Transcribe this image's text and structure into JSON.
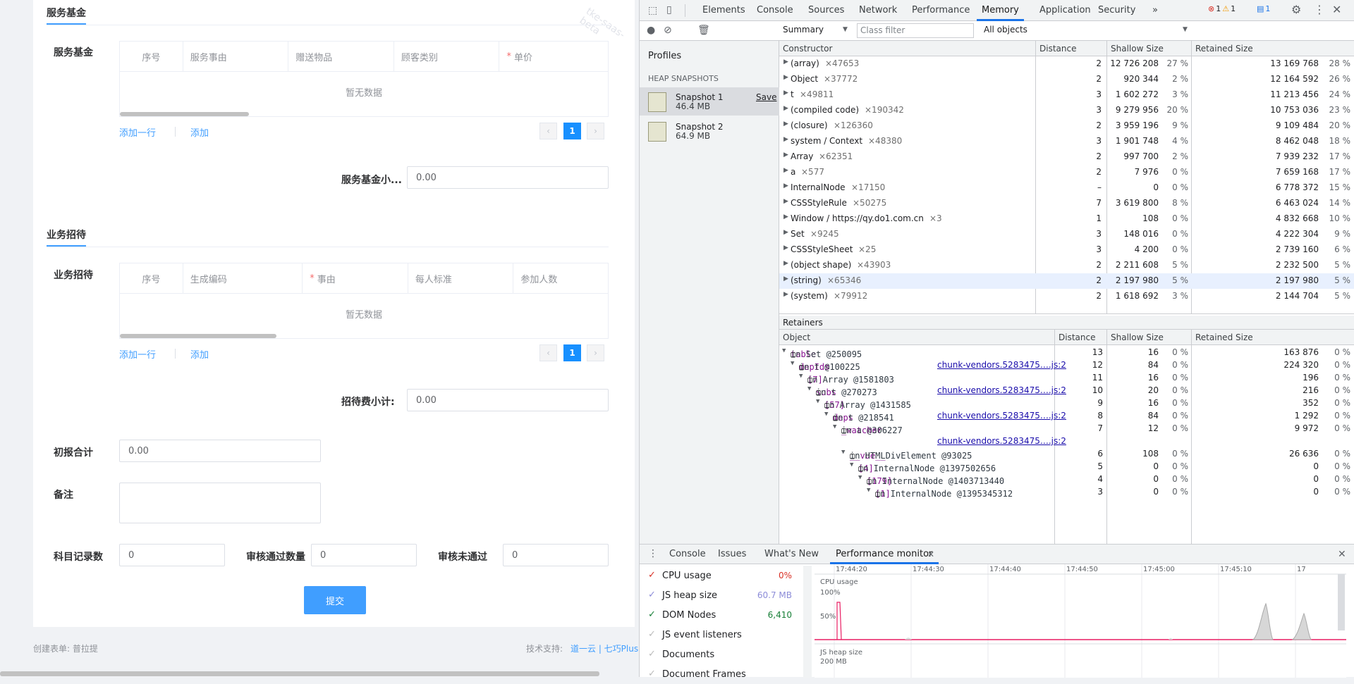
{
  "form": {
    "section1_title": "服务基金",
    "section1_label": "服务基金",
    "table1_headers": [
      "序号",
      "服务事由",
      "赠送物品",
      "顾客类别",
      "单价"
    ],
    "table1_empty": "暂无数据",
    "add_row": "添加一行",
    "add": "添加",
    "page_current": "1",
    "subtotal1_label": "服务基金小...",
    "subtotal1_value": "0.00",
    "section2_title": "业务招待",
    "section2_label": "业务招待",
    "table2_headers": [
      "序号",
      "生成编码",
      "事由",
      "每人标准",
      "参加人数"
    ],
    "table2_empty": "暂无数据",
    "subtotal2_label": "招待费小计:",
    "subtotal2_value": "0.00",
    "total_label": "初报合计",
    "total_value": "0.00",
    "remark_label": "备注",
    "count_label": "科目记录数",
    "count_value": "0",
    "passed_label": "审核通过数量",
    "passed_value": "0",
    "rejected_label": "审核未通过",
    "rejected_value": "0",
    "submit": "提交",
    "creator": "创建表单: 普拉提",
    "support_label": "技术支持:",
    "support_link": "道一云 | 七巧Plus",
    "watermark": "tke-saas-beta"
  },
  "devtools": {
    "tabs": [
      "Elements",
      "Console",
      "Sources",
      "Network",
      "Performance",
      "Memory",
      "Application",
      "Security"
    ],
    "active_tab": "Memory",
    "more": "»",
    "errors": "1",
    "warnings": "1",
    "messages": "1",
    "summary_select": "Summary",
    "class_filter_placeholder": "Class filter",
    "objects_select": "All objects",
    "profiles_label": "Profiles",
    "heap_snapshots": "HEAP SNAPSHOTS",
    "snapshots": [
      {
        "name": "Snapshot 1",
        "size": "46.4 MB",
        "save": "Save"
      },
      {
        "name": "Snapshot 2",
        "size": "64.9 MB",
        "save": ""
      }
    ],
    "grid_headers": [
      "Constructor",
      "Distance",
      "Shallow Size",
      "Retained Size"
    ],
    "rows": [
      {
        "name": "(array)",
        "count": "×47653",
        "dist": "2",
        "shallow": "12 726 208",
        "sp": "27 %",
        "retained": "13 169 768",
        "rp": "28 %"
      },
      {
        "name": "Object",
        "count": "×37772",
        "dist": "2",
        "shallow": "920 344",
        "sp": "2 %",
        "retained": "12 164 592",
        "rp": "26 %"
      },
      {
        "name": "t",
        "count": "×49811",
        "dist": "3",
        "shallow": "1 602 272",
        "sp": "3 %",
        "retained": "11 213 456",
        "rp": "24 %"
      },
      {
        "name": "(compiled code)",
        "count": "×190342",
        "dist": "3",
        "shallow": "9 279 956",
        "sp": "20 %",
        "retained": "10 753 036",
        "rp": "23 %"
      },
      {
        "name": "(closure)",
        "count": "×126360",
        "dist": "2",
        "shallow": "3 959 196",
        "sp": "9 %",
        "retained": "9 109 484",
        "rp": "20 %"
      },
      {
        "name": "system / Context",
        "count": "×48380",
        "dist": "3",
        "shallow": "1 901 748",
        "sp": "4 %",
        "retained": "8 462 048",
        "rp": "18 %"
      },
      {
        "name": "Array",
        "count": "×62351",
        "dist": "2",
        "shallow": "997 700",
        "sp": "2 %",
        "retained": "7 939 232",
        "rp": "17 %"
      },
      {
        "name": "a",
        "count": "×577",
        "dist": "2",
        "shallow": "7 976",
        "sp": "0 %",
        "retained": "7 659 168",
        "rp": "17 %"
      },
      {
        "name": "InternalNode",
        "count": "×17150",
        "dist": "–",
        "shallow": "0",
        "sp": "0 %",
        "retained": "6 778 372",
        "rp": "15 %"
      },
      {
        "name": "CSSStyleRule",
        "count": "×50275",
        "dist": "7",
        "shallow": "3 619 800",
        "sp": "8 %",
        "retained": "6 463 024",
        "rp": "14 %"
      },
      {
        "name": "Window / https://qy.do1.com.cn",
        "count": "×3",
        "dist": "1",
        "shallow": "108",
        "sp": "0 %",
        "retained": "4 832 668",
        "rp": "10 %"
      },
      {
        "name": "Set",
        "count": "×9245",
        "dist": "3",
        "shallow": "148 016",
        "sp": "0 %",
        "retained": "4 222 304",
        "rp": "9 %"
      },
      {
        "name": "CSSStyleSheet",
        "count": "×25",
        "dist": "3",
        "shallow": "4 200",
        "sp": "0 %",
        "retained": "2 739 160",
        "rp": "6 %"
      },
      {
        "name": "(object shape)",
        "count": "×43903",
        "dist": "2",
        "shallow": "2 211 608",
        "sp": "5 %",
        "retained": "2 232 500",
        "rp": "5 %"
      },
      {
        "name": "(string)",
        "count": "×65346",
        "dist": "2",
        "shallow": "2 197 980",
        "sp": "5 %",
        "retained": "2 197 980",
        "rp": "5 %"
      },
      {
        "name": "(system)",
        "count": "×79912",
        "dist": "2",
        "shallow": "1 618 692",
        "sp": "3 %",
        "retained": "2 144 704",
        "rp": "5 %"
      }
    ],
    "retainers_label": "Retainers",
    "ret_headers": [
      "Object",
      "Distance",
      "Shallow Size",
      "Retained Size"
    ],
    "ret_rows": [
      {
        "prop": "table",
        "rest": " in Set @250095 ",
        "src": "",
        "dist": "13",
        "shallow": "16",
        "sp": "0 %",
        "retained": "163 876",
        "rp": "0 %"
      },
      {
        "prop": "depIds",
        "rest": " in t @100225 ",
        "src": "chunk-vendors.5283475….js:2",
        "dist": "12",
        "shallow": "84",
        "sp": "0 %",
        "retained": "224 320",
        "rp": "0 %"
      },
      {
        "prop": "[7]",
        "rest": " in Array @1581803 ",
        "src": "",
        "dist": "11",
        "shallow": "16",
        "sp": "0 %",
        "retained": "196",
        "rp": "0 %"
      },
      {
        "prop": "subs",
        "rest": " in t @270273 ",
        "src": "chunk-vendors.5283475….js:2",
        "dist": "10",
        "shallow": "20",
        "sp": "0 %",
        "retained": "216",
        "rp": "0 %"
      },
      {
        "prop": "[57]",
        "rest": " in Array @1431585 ",
        "src": "",
        "dist": "9",
        "shallow": "16",
        "sp": "0 %",
        "retained": "352",
        "rp": "0 %"
      },
      {
        "prop": "deps",
        "rest": " in t @218541 ",
        "src": "chunk-vendors.5283475….js:2",
        "dist": "8",
        "shallow": "84",
        "sp": "0 %",
        "retained": "1 292",
        "rp": "0 %"
      },
      {
        "prop": "_watcher",
        "rest": " in a @306227 ",
        "src": "",
        "dist": "7",
        "shallow": "12",
        "sp": "0 %",
        "retained": "9 972",
        "rp": "0 %"
      },
      {
        "prop": "",
        "rest": "",
        "src": "chunk-vendors.5283475….js:2",
        "dist": "",
        "shallow": "",
        "sp": "",
        "retained": "",
        "rp": ""
      },
      {
        "prop": "__vue__",
        "rest": " in HTMLDivElement @93025 ",
        "src": "",
        "dist": "6",
        "shallow": "108",
        "sp": "0 %",
        "retained": "26 636",
        "rp": "0 %"
      },
      {
        "prop": "[4]",
        "rest": " in InternalNode @1397502656 ",
        "src": "",
        "dist": "5",
        "shallow": "0",
        "sp": "0 %",
        "retained": "0",
        "rp": "0 %"
      },
      {
        "prop": "[179]",
        "rest": " in InternalNode @1403713440 ",
        "src": "",
        "dist": "4",
        "shallow": "0",
        "sp": "0 %",
        "retained": "0",
        "rp": "0 %"
      },
      {
        "prop": "[1]",
        "rest": " in InternalNode @1395345312 ",
        "src": "",
        "dist": "3",
        "shallow": "0",
        "sp": "0 %",
        "retained": "0",
        "rp": "0 %"
      }
    ],
    "drawer_tabs": [
      "Console",
      "Issues",
      "What's New",
      "Performance monitor"
    ],
    "drawer_active": "Performance monitor",
    "metrics": [
      {
        "name": "CPU usage",
        "value": "0%",
        "color": "#d93025",
        "checked": true
      },
      {
        "name": "JS heap size",
        "value": "60.7 MB",
        "color": "#8c8cd8",
        "checked": true
      },
      {
        "name": "DOM Nodes",
        "value": "6,410",
        "color": "#188038",
        "checked": true
      },
      {
        "name": "JS event listeners",
        "value": "",
        "color": "#999999",
        "checked": false
      },
      {
        "name": "Documents",
        "value": "",
        "color": "#999999",
        "checked": false
      },
      {
        "name": "Document Frames",
        "value": "",
        "color": "#999999",
        "checked": false
      }
    ],
    "chart_times": [
      "17:44:20",
      "17:44:30",
      "17:44:40",
      "17:44:50",
      "17:45:00",
      "17:45:10",
      "17"
    ],
    "chart_cpu_label": "CPU usage",
    "chart_cpu_ticks": [
      "100%",
      "50%"
    ],
    "chart_heap_label": "JS heap size",
    "chart_heap_tick": "200 MB"
  }
}
